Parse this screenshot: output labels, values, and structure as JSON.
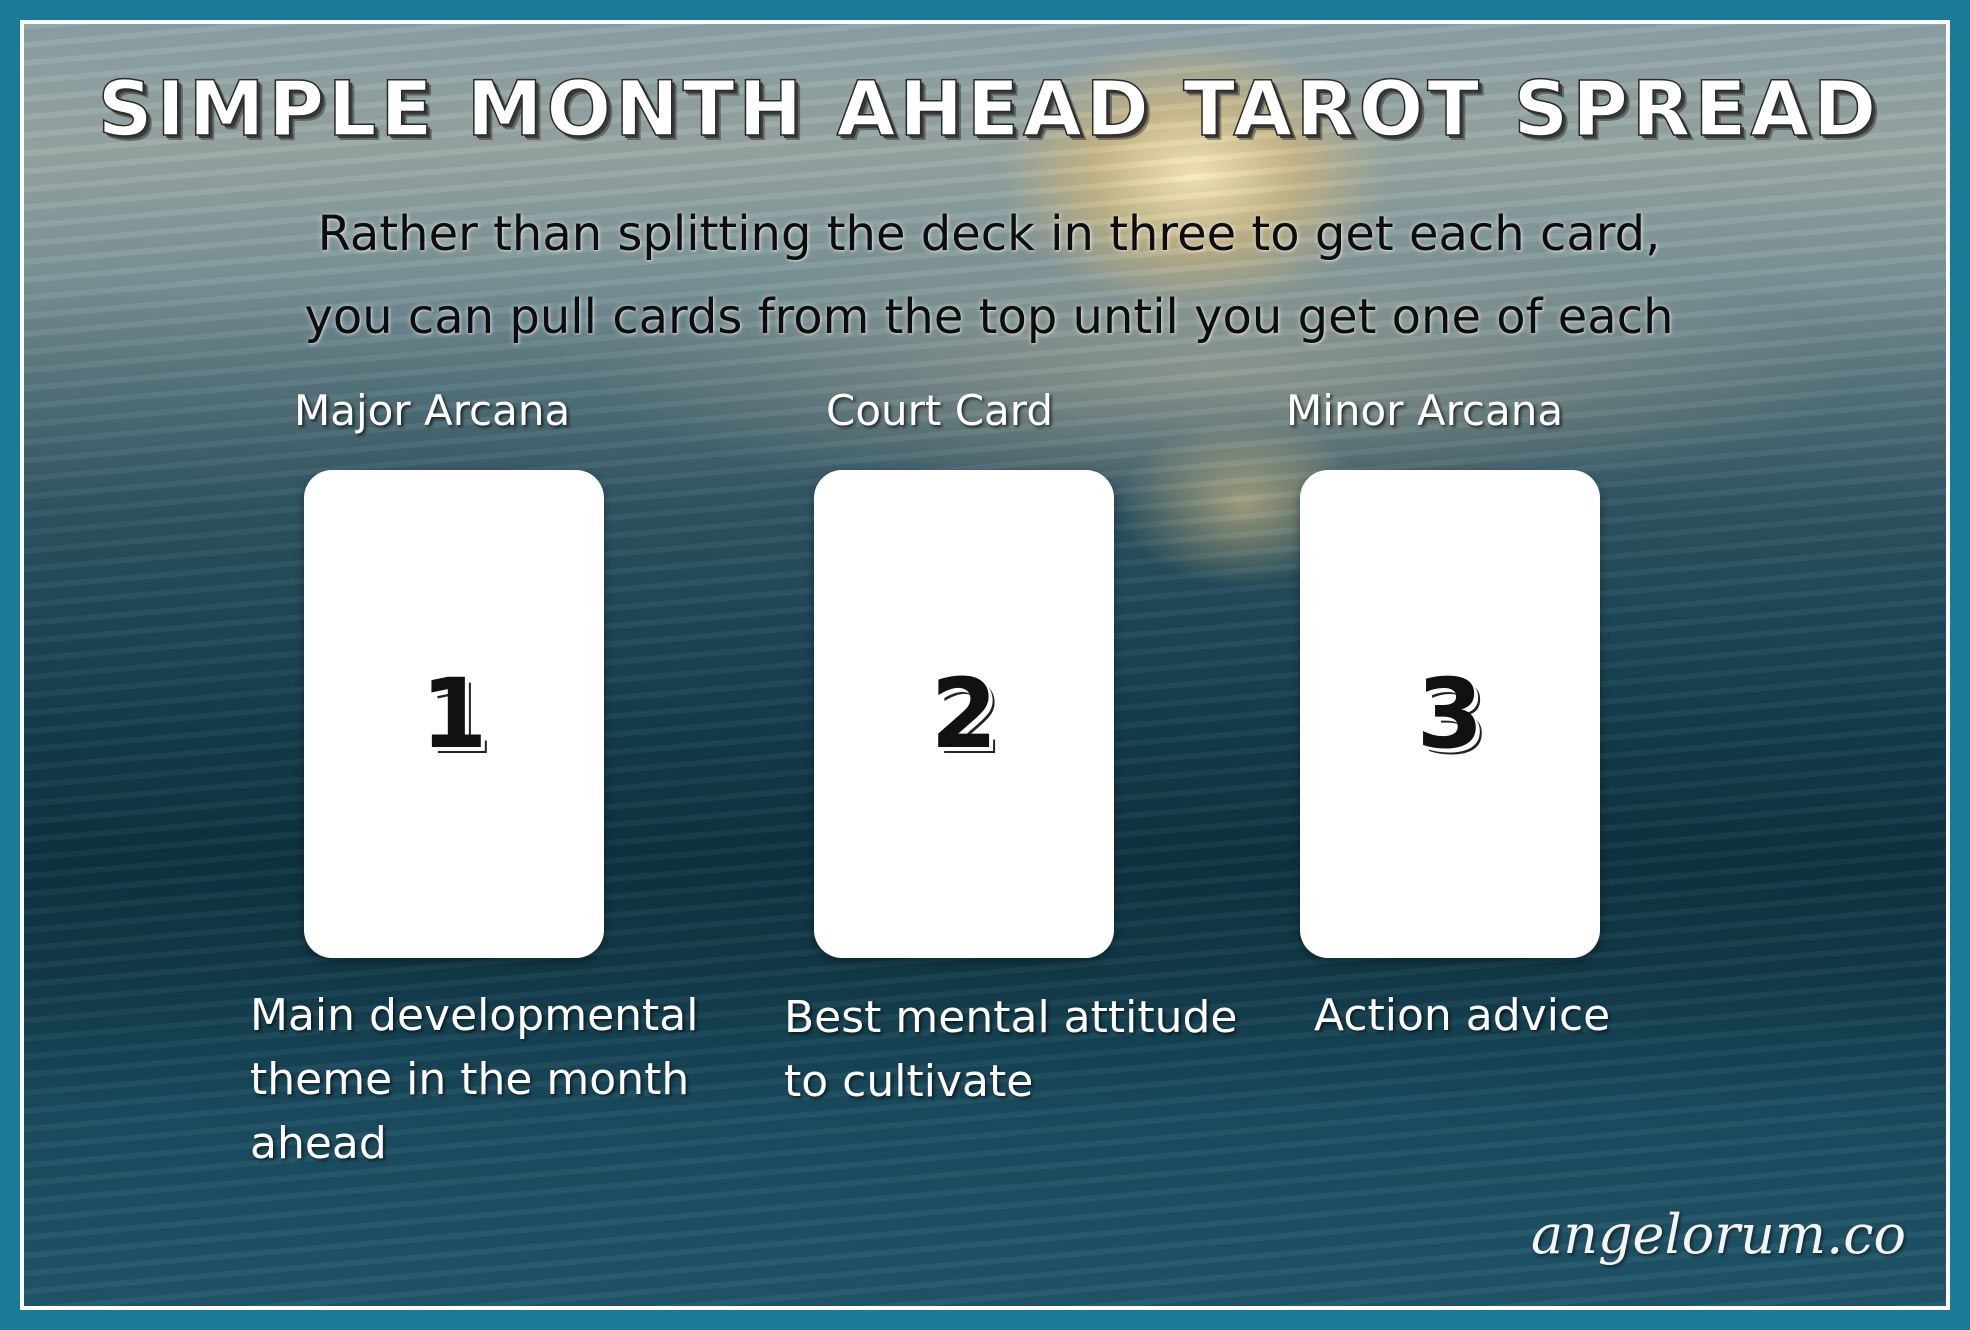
{
  "title": "Simple Month Ahead Tarot Spread",
  "subtitle": {
    "line1": "Rather than splitting the deck in three to get each card,",
    "line2": "you can pull cards from the top until you get one of each"
  },
  "positions": [
    {
      "label": "Major Arcana",
      "number": "1",
      "description": [
        "Main developmental",
        "theme in the month",
        "ahead"
      ]
    },
    {
      "label": "Court Card",
      "number": "2",
      "description": [
        "Best mental attitude",
        "to cultivate"
      ]
    },
    {
      "label": "Minor Arcana",
      "number": "3",
      "description": [
        "Action advice"
      ]
    }
  ],
  "brand": "angelorum.co",
  "colors": {
    "frame": "#1b7a95",
    "border": "#ffffff",
    "card": "#ffffff"
  }
}
